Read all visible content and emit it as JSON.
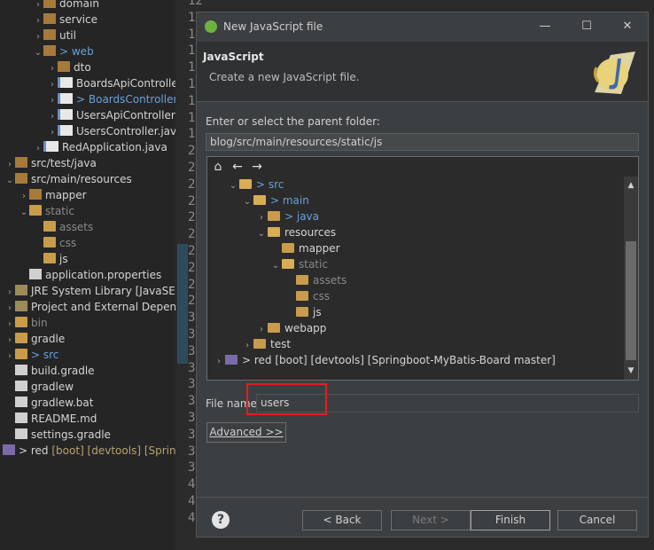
{
  "explorer": {
    "items": [
      {
        "label": "domain",
        "indent": 3,
        "arrow": "›",
        "icon": "pkg",
        "cls": ""
      },
      {
        "label": "service",
        "indent": 3,
        "arrow": "›",
        "icon": "pkg",
        "cls": ""
      },
      {
        "label": "util",
        "indent": 3,
        "arrow": "›",
        "icon": "pkg",
        "cls": ""
      },
      {
        "label": "> web",
        "indent": 3,
        "arrow": "⌄",
        "icon": "pkg",
        "cls": "blue"
      },
      {
        "label": "dto",
        "indent": 4,
        "arrow": "›",
        "icon": "pkg",
        "cls": ""
      },
      {
        "label": "BoardsApiController",
        "indent": 4,
        "arrow": "›",
        "icon": "javaf",
        "cls": ""
      },
      {
        "label": "> BoardsController.j",
        "indent": 4,
        "arrow": "›",
        "icon": "javaf",
        "cls": "blue"
      },
      {
        "label": "UsersApiController.j",
        "indent": 4,
        "arrow": "›",
        "icon": "javaf",
        "cls": ""
      },
      {
        "label": "UsersController.java",
        "indent": 4,
        "arrow": "›",
        "icon": "javaf",
        "cls": ""
      },
      {
        "label": "RedApplication.java",
        "indent": 3,
        "arrow": "›",
        "icon": "javaf",
        "cls": ""
      },
      {
        "label": "src/test/java",
        "indent": 1,
        "arrow": "›",
        "icon": "pkg",
        "cls": ""
      },
      {
        "label": "src/main/resources",
        "indent": 1,
        "arrow": "⌄",
        "icon": "pkg",
        "cls": ""
      },
      {
        "label": "mapper",
        "indent": 2,
        "arrow": "›",
        "icon": "pkg",
        "cls": ""
      },
      {
        "label": "static",
        "indent": 2,
        "arrow": "⌄",
        "icon": "folder",
        "cls": "dim"
      },
      {
        "label": "assets",
        "indent": 3,
        "arrow": "",
        "icon": "folder",
        "cls": "dim"
      },
      {
        "label": "css",
        "indent": 3,
        "arrow": "",
        "icon": "folder",
        "cls": "dim"
      },
      {
        "label": "js",
        "indent": 3,
        "arrow": "",
        "icon": "folder",
        "cls": ""
      },
      {
        "label": "application.properties",
        "indent": 2,
        "arrow": "",
        "icon": "gfile",
        "cls": ""
      },
      {
        "label": "JRE System Library [JavaSE-1",
        "indent": 1,
        "arrow": "›",
        "icon": "jar",
        "cls": ""
      },
      {
        "label": "Project and External Depende",
        "indent": 1,
        "arrow": "›",
        "icon": "jar",
        "cls": ""
      },
      {
        "label": "bin",
        "indent": 1,
        "arrow": "›",
        "icon": "folder",
        "cls": "dim"
      },
      {
        "label": "gradle",
        "indent": 1,
        "arrow": "›",
        "icon": "folder",
        "cls": ""
      },
      {
        "label": "> src",
        "indent": 1,
        "arrow": "›",
        "icon": "folder",
        "cls": "blue"
      },
      {
        "label": "build.gradle",
        "indent": 1,
        "arrow": "",
        "icon": "gfile",
        "cls": ""
      },
      {
        "label": "gradlew",
        "indent": 1,
        "arrow": "",
        "icon": "gfile",
        "cls": ""
      },
      {
        "label": "gradlew.bat",
        "indent": 1,
        "arrow": "",
        "icon": "gfile",
        "cls": ""
      },
      {
        "label": "README.md",
        "indent": 1,
        "arrow": "",
        "icon": "gfile",
        "cls": ""
      },
      {
        "label": "settings.gradle",
        "indent": 1,
        "arrow": "",
        "icon": "gfile",
        "cls": ""
      }
    ],
    "root_prefix": "> red",
    "root_suffix": "[boot] [devtools] [Springb"
  },
  "editor": {
    "line_numbers": [
      "12",
      "1",
      "1",
      "1",
      "1",
      "1",
      "1",
      "1",
      "1",
      "2",
      "2",
      "2",
      "2",
      "2",
      "2",
      "2",
      "2",
      "2",
      "2",
      "3",
      "3",
      "3",
      "3",
      "3",
      "3",
      "3",
      "3",
      "3",
      "3",
      "4",
      "4",
      "4"
    ]
  },
  "dialog": {
    "window_title": "New JavaScript file",
    "minimize": "—",
    "maximize": "☐",
    "close": "✕",
    "banner_title": "JavaScript",
    "banner_subtitle": "Create a new JavaScript file.",
    "parent_folder_label": "Enter or select the parent folder:",
    "parent_folder_value": "blog/src/main/resources/static/js",
    "toolbar": {
      "home": "⌂",
      "back": "←",
      "forward": "→"
    },
    "tree": [
      {
        "label": "> src",
        "indent": 1,
        "arrow": "⌄",
        "icon": "folder open",
        "cls": "blue"
      },
      {
        "label": "> main",
        "indent": 2,
        "arrow": "⌄",
        "icon": "folder open",
        "cls": "blue"
      },
      {
        "label": "> java",
        "indent": 3,
        "arrow": "›",
        "icon": "folder",
        "cls": "blue"
      },
      {
        "label": "resources",
        "indent": 3,
        "arrow": "⌄",
        "icon": "folder open",
        "cls": ""
      },
      {
        "label": "mapper",
        "indent": 4,
        "arrow": "",
        "icon": "folder",
        "cls": ""
      },
      {
        "label": "static",
        "indent": 4,
        "arrow": "⌄",
        "icon": "folder open",
        "cls": "dim"
      },
      {
        "label": "assets",
        "indent": 5,
        "arrow": "",
        "icon": "folder",
        "cls": "dim"
      },
      {
        "label": "css",
        "indent": 5,
        "arrow": "",
        "icon": "folder",
        "cls": "dim"
      },
      {
        "label": "js",
        "indent": 5,
        "arrow": "",
        "icon": "folder",
        "cls": ""
      },
      {
        "label": "webapp",
        "indent": 3,
        "arrow": "›",
        "icon": "folder",
        "cls": ""
      },
      {
        "label": "test",
        "indent": 2,
        "arrow": "›",
        "icon": "folder",
        "cls": ""
      },
      {
        "label": "> red [boot] [devtools] [Springboot-MyBatis-Board master]",
        "indent": 0,
        "arrow": "›",
        "icon": "proj",
        "cls": ""
      }
    ],
    "file_name_label": "File name:",
    "file_name_value": "users",
    "advanced_label": "Advanced >>",
    "help": "?",
    "buttons": {
      "back": "< Back",
      "next": "Next >",
      "finish": "Finish",
      "cancel": "Cancel"
    }
  }
}
